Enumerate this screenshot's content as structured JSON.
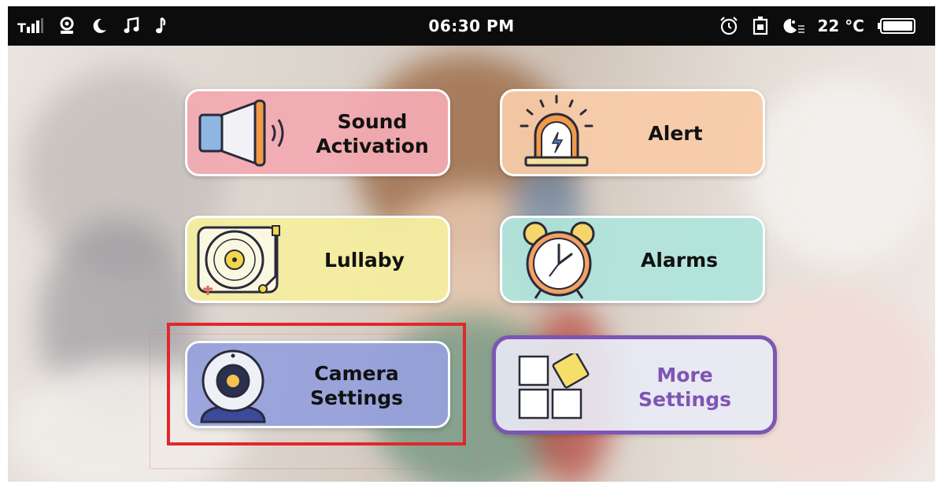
{
  "status_bar": {
    "time": "06:30 PM",
    "temperature": "22 °C",
    "left_icons": [
      "signal-icon",
      "camera-icon",
      "night-mode-icon",
      "music-icon",
      "lullaby-note-icon"
    ],
    "right_icons": [
      "alarm-clock-icon",
      "timer-icon",
      "brightness-icon",
      "battery-icon"
    ],
    "battery_level": 1.0
  },
  "menu": {
    "sound_activation": {
      "label": "Sound\nActivation",
      "icon": "speaker-icon",
      "color": "#f3aab1"
    },
    "alert": {
      "label": "Alert",
      "icon": "siren-icon",
      "color": "#f7cba8"
    },
    "lullaby": {
      "label": "Lullaby",
      "icon": "turntable-icon",
      "color": "#f4ee9e"
    },
    "alarms": {
      "label": "Alarms",
      "icon": "alarm-clock-icon",
      "color": "#afe4dc"
    },
    "camera_settings": {
      "label": "Camera\nSettings",
      "icon": "webcam-icon",
      "color": "#96a0dc"
    },
    "more_settings": {
      "label": "More\nSettings",
      "icon": "grid-icon",
      "color": "#7e55b4"
    }
  },
  "highlight": {
    "target": "camera_settings",
    "color": "#e0272d"
  }
}
